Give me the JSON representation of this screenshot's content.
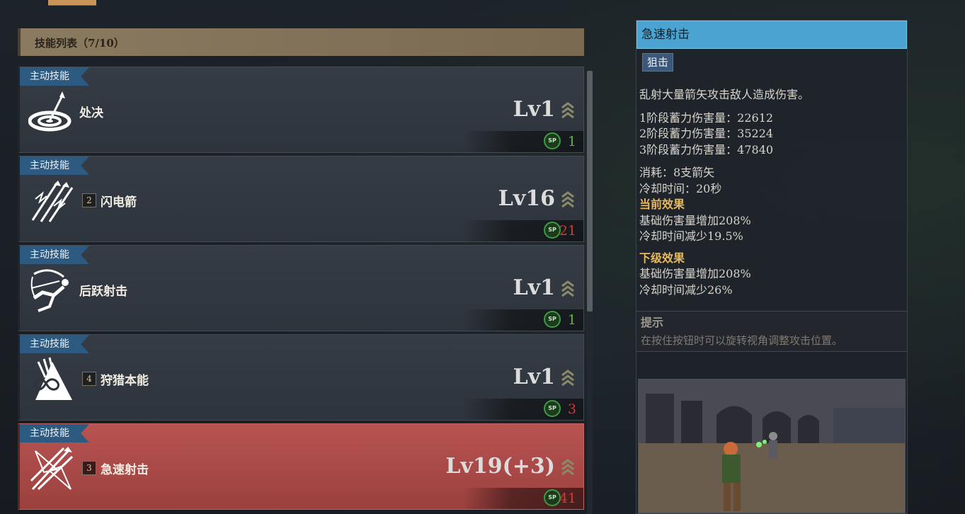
{
  "list": {
    "header": "技能列表（7/10）",
    "skills": [
      {
        "tag": "主动技能",
        "num": "",
        "name": "处决",
        "level": "Lv1",
        "sp": "1",
        "sp_color": "green",
        "selected": false,
        "icon": "archery-target-icon"
      },
      {
        "tag": "主动技能",
        "num": "2",
        "name": "闪电箭",
        "level": "Lv16",
        "sp": "21",
        "sp_color": "red",
        "selected": false,
        "icon": "lightning-arrows-icon"
      },
      {
        "tag": "主动技能",
        "num": "",
        "name": "后跃射击",
        "level": "Lv1",
        "sp": "1",
        "sp_color": "green",
        "selected": false,
        "icon": "backflip-archer-icon"
      },
      {
        "tag": "主动技能",
        "num": "4",
        "name": "狩猎本能",
        "level": "Lv1",
        "sp": "3",
        "sp_color": "red",
        "selected": false,
        "icon": "hunting-instinct-icon"
      },
      {
        "tag": "主动技能",
        "num": "3",
        "name": "急速射击",
        "level": "Lv19(+3)",
        "sp": "41",
        "sp_color": "red",
        "selected": true,
        "icon": "rapid-shot-icon"
      }
    ],
    "sp_icon_text": "SP"
  },
  "detail": {
    "title": "急速射击",
    "tag": "狙击",
    "description": "乱射大量箭矢攻击敌人造成伤害。",
    "stage1": "1阶段蓄力伤害量：22612",
    "stage2": "2阶段蓄力伤害量：35224",
    "stage3": "3阶段蓄力伤害量：47840",
    "cost": "消耗：8支箭矢",
    "cooldown": "冷却时间：20秒",
    "current_header": "当前效果",
    "current_line1": "基础伤害量增加208%",
    "current_line2": "冷却时间减少19.5%",
    "next_header": "下级效果",
    "next_line1": "基础伤害量增加208%",
    "next_line2": "冷却时间减少26%",
    "tip_header": "提示",
    "tip_text": "在按住按钮时可以旋转视角调整攻击位置。"
  },
  "colors": {
    "accent_blue": "#4aa3d1",
    "selected_red": "#b85452",
    "sp_green": "#63b33a",
    "sp_red": "#d03a34",
    "effect_header": "#e7b85d"
  }
}
